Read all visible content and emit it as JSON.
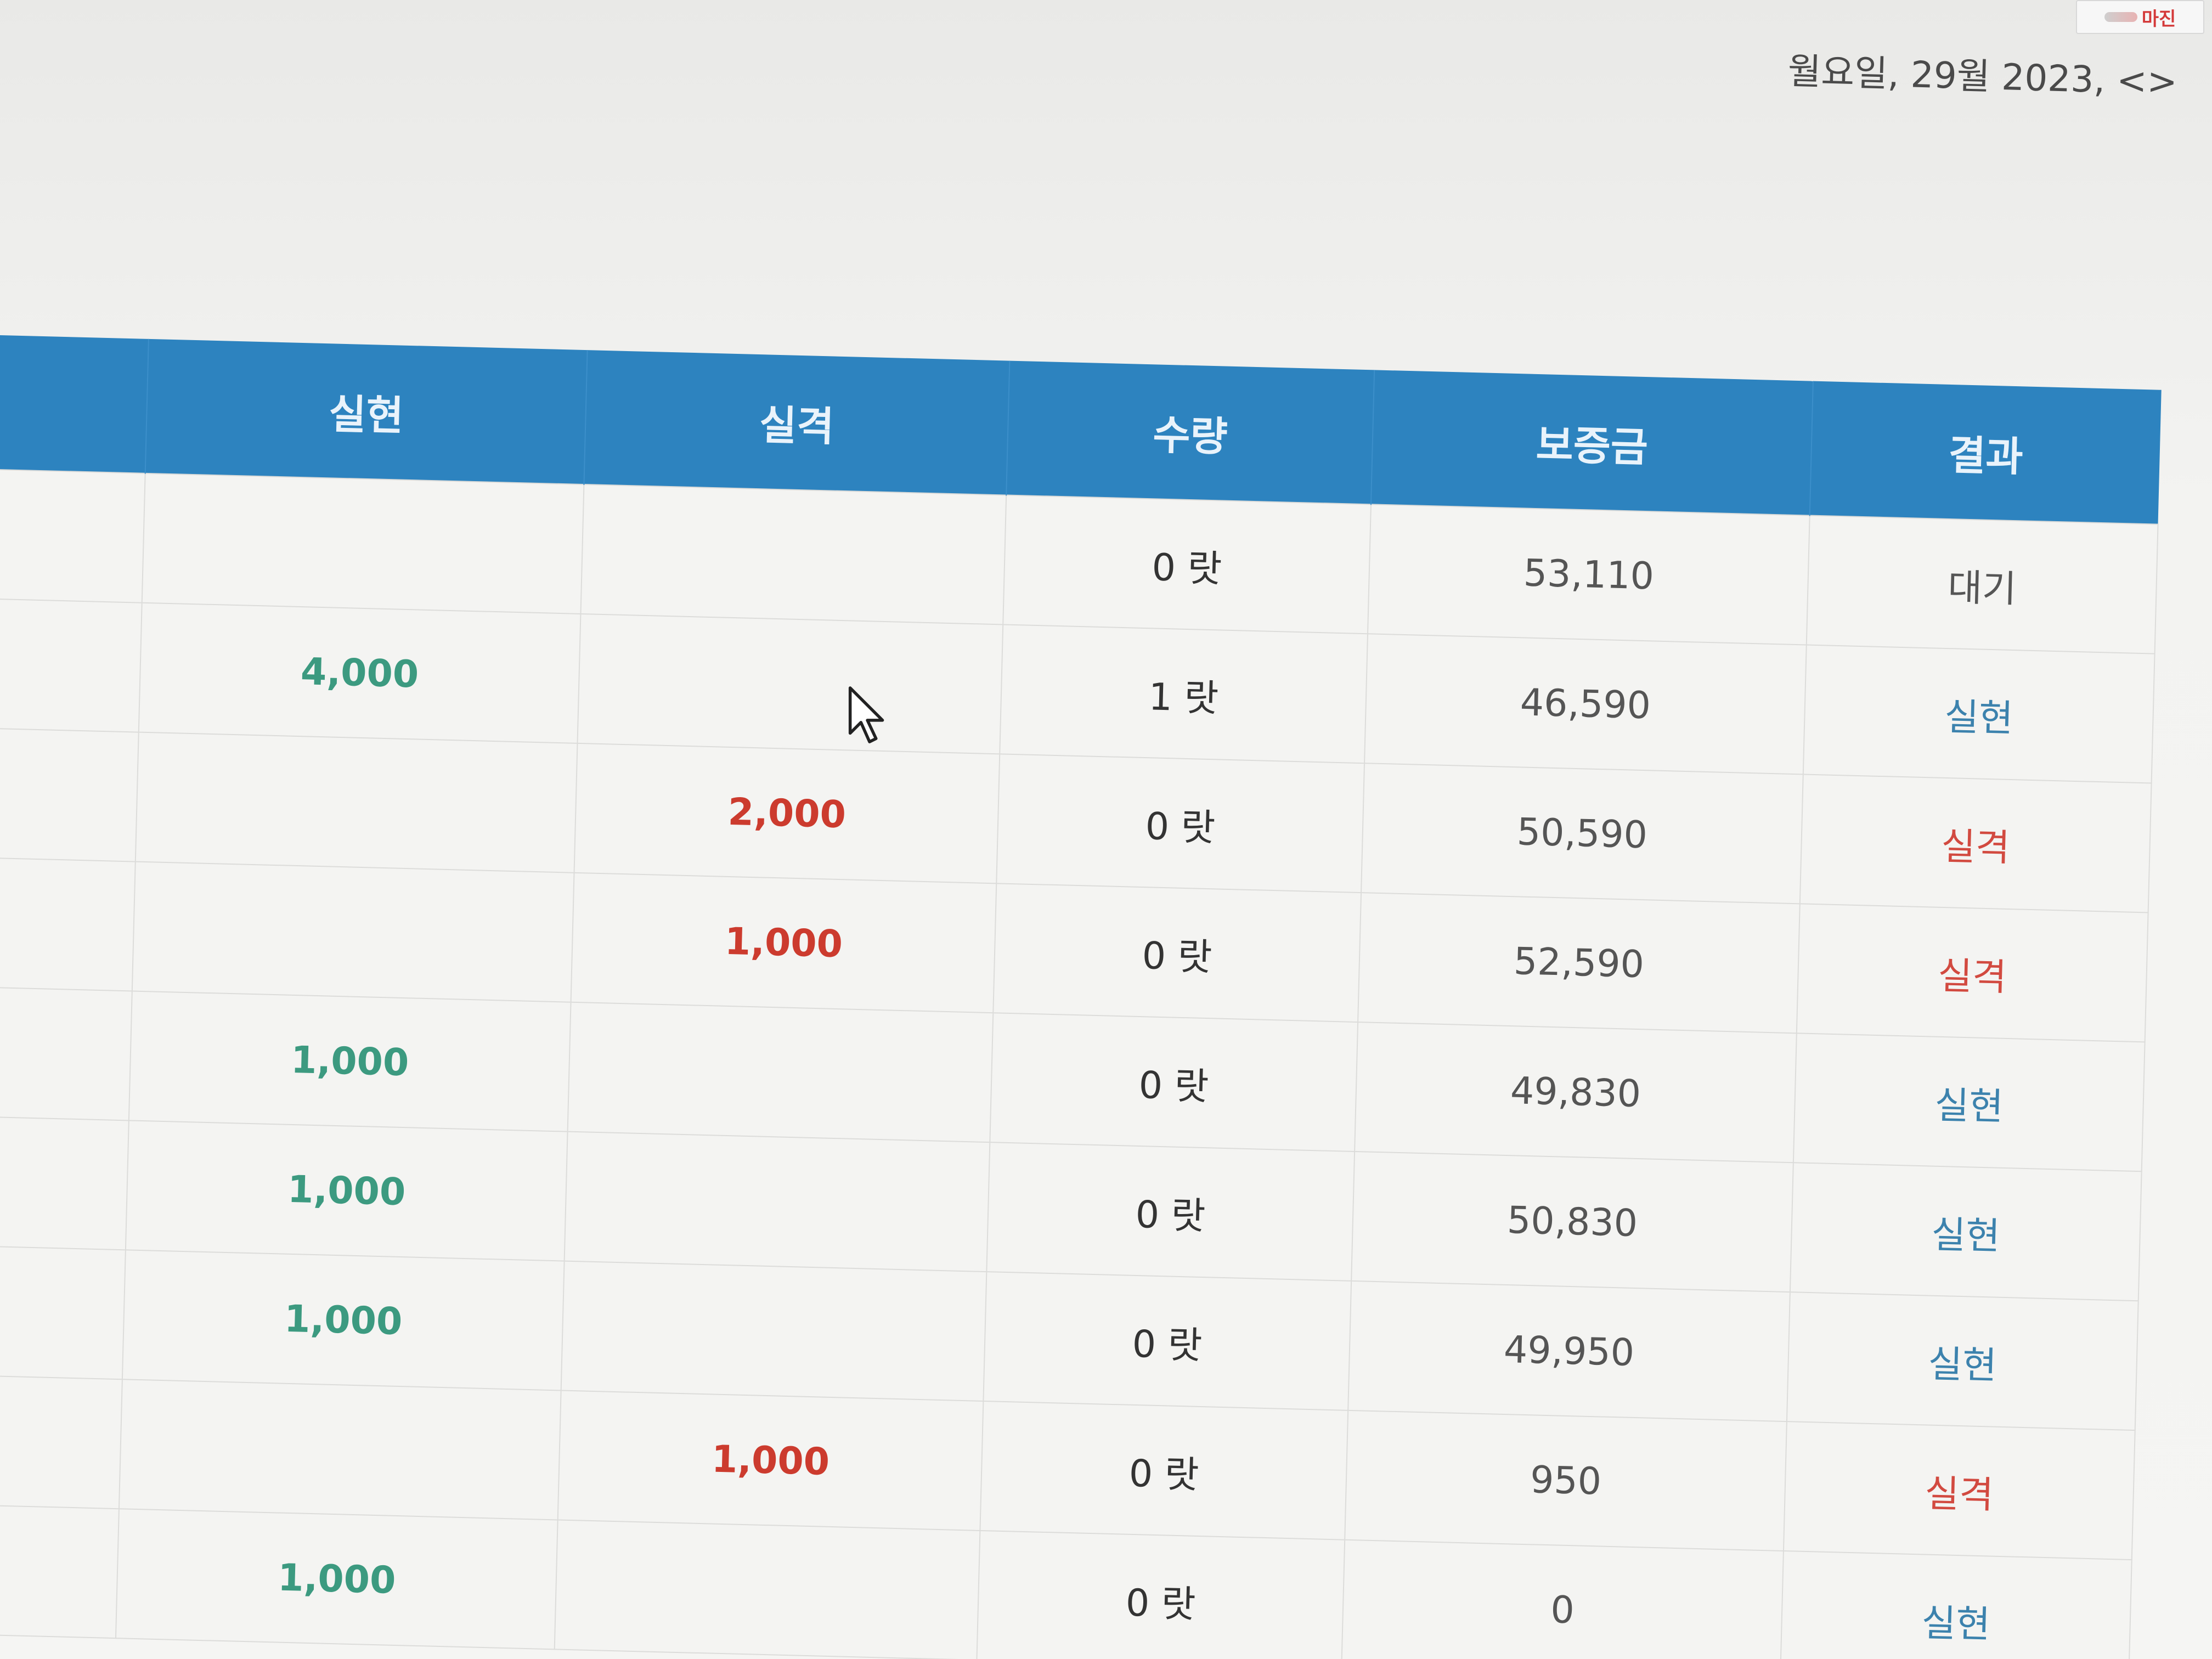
{
  "watermark": {
    "text": "마진"
  },
  "header": {
    "date_text": "월요일, 29월 2023, <>"
  },
  "table": {
    "columns": [
      "실현",
      "실격",
      "수량",
      "보증금",
      "결과"
    ],
    "rows": [
      {
        "gain": "",
        "loss": "",
        "qty": "0 랏",
        "deposit": "53,110",
        "result": "대기",
        "result_status": "wait"
      },
      {
        "gain": "4,000",
        "loss": "",
        "qty": "1 랏",
        "deposit": "46,590",
        "result": "실현",
        "result_status": "gain"
      },
      {
        "gain": "",
        "loss": "2,000",
        "qty": "0 랏",
        "deposit": "50,590",
        "result": "실격",
        "result_status": "loss"
      },
      {
        "gain": "",
        "loss": "1,000",
        "qty": "0 랏",
        "deposit": "52,590",
        "result": "실격",
        "result_status": "loss"
      },
      {
        "gain": "1,000",
        "loss": "",
        "qty": "0 랏",
        "deposit": "49,830",
        "result": "실현",
        "result_status": "gain"
      },
      {
        "gain": "1,000",
        "loss": "",
        "qty": "0 랏",
        "deposit": "50,830",
        "result": "실현",
        "result_status": "gain"
      },
      {
        "gain": "1,000",
        "loss": "",
        "qty": "0 랏",
        "deposit": "49,950",
        "result": "실현",
        "result_status": "gain"
      },
      {
        "gain": "",
        "loss": "1,000",
        "qty": "0 랏",
        "deposit": "950",
        "result": "실격",
        "result_status": "loss"
      },
      {
        "gain": "1,000",
        "loss": "",
        "qty": "0 랏",
        "deposit": "0",
        "result": "실현",
        "result_status": "gain"
      }
    ]
  },
  "colors": {
    "header_bg": "#2d83bf",
    "gain": "#3c9a80",
    "loss": "#cc3b2e",
    "result_gain": "#3c82ad",
    "result_loss": "#d24a40"
  },
  "cursor": {
    "icon": "pointer-arrow-icon"
  }
}
